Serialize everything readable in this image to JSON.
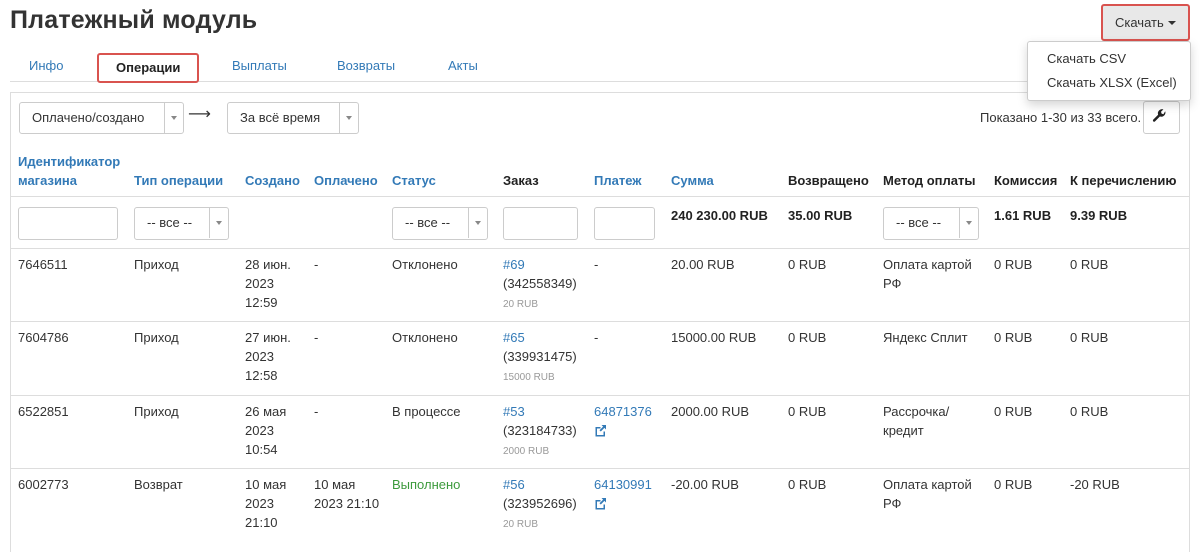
{
  "page": {
    "title": "Платежный модуль"
  },
  "tabs": [
    {
      "label": "Инфо"
    },
    {
      "label": "Операции"
    },
    {
      "label": "Выплаты"
    },
    {
      "label": "Возвраты"
    },
    {
      "label": "Акты"
    }
  ],
  "download": {
    "label": "Скачать",
    "menu": [
      "Скачать CSV",
      "Скачать XLSX (Excel)"
    ]
  },
  "filters": {
    "date_type": "Оплачено/создано",
    "arrow": "⟶",
    "period": "За всё время",
    "shown": "Показано 1-30 из 33 всего."
  },
  "columns": [
    {
      "line1": "Идентификатор",
      "line2": "магазина"
    },
    {
      "line1": "Тип операции"
    },
    {
      "line1": "Создано"
    },
    {
      "line1": "Оплачено"
    },
    {
      "line1": "Статус"
    },
    {
      "line1": "Заказ"
    },
    {
      "line1": "Платеж"
    },
    {
      "line1": "Сумма"
    },
    {
      "line1": "Возвращено"
    },
    {
      "line1": "Метод оплаты"
    },
    {
      "line1": "Комиссия"
    },
    {
      "line1": "К перечислению"
    }
  ],
  "filter_row": {
    "all_label": "-- все --",
    "totals": {
      "sum": "240 230.00 RUB",
      "refunded": "35.00 RUB",
      "commission": "1.61 RUB",
      "payout": "9.39 RUB"
    }
  },
  "rows": [
    {
      "shop_id": "7646511",
      "type": "Приход",
      "created": [
        "28 июн.",
        "2023",
        "12:59"
      ],
      "paid": "-",
      "status": "Отклонено",
      "status_color": "#333333",
      "order": "#69",
      "order_num": "(342558349)",
      "order_amount": "20 RUB",
      "payment": "-",
      "payment_link": false,
      "sum": "20.00 RUB",
      "refunded": "0 RUB",
      "method": [
        "Оплата картой",
        "РФ"
      ],
      "commission": "0 RUB",
      "payout": "0 RUB"
    },
    {
      "shop_id": "7604786",
      "type": "Приход",
      "created": [
        "27 июн.",
        "2023",
        "12:58"
      ],
      "paid": "-",
      "status": "Отклонено",
      "status_color": "#333333",
      "order": "#65",
      "order_num": "(339931475)",
      "order_amount": "15000 RUB",
      "payment": "-",
      "payment_link": false,
      "sum": "15000.00 RUB",
      "refunded": "0 RUB",
      "method": [
        "Яндекс Сплит"
      ],
      "commission": "0 RUB",
      "payout": "0 RUB"
    },
    {
      "shop_id": "6522851",
      "type": "Приход",
      "created": [
        "26 мая",
        "2023",
        "10:54"
      ],
      "paid": "-",
      "status": "В процессе",
      "status_color": "#333333",
      "order": "#53",
      "order_num": "(323184733)",
      "order_amount": "2000 RUB",
      "payment": "64871376",
      "payment_link": true,
      "sum": "2000.00 RUB",
      "refunded": "0 RUB",
      "method": [
        "Рассрочка/",
        "кредит"
      ],
      "commission": "0 RUB",
      "payout": "0 RUB"
    },
    {
      "shop_id": "6002773",
      "type": "Возврат",
      "created": [
        "10 мая",
        "2023",
        "21:10"
      ],
      "paid": "10 мая 2023 21:10",
      "status": "Выполнено",
      "status_color": "#3c9a3c",
      "order": "#56",
      "order_num": "(323952696)",
      "order_amount": "20 RUB",
      "payment": "64130991",
      "payment_link": true,
      "sum": "-20.00 RUB",
      "refunded": "0 RUB",
      "method": [
        "Оплата картой",
        "РФ"
      ],
      "commission": "0 RUB",
      "payout": "-20 RUB"
    }
  ],
  "icons": {
    "wrench": "wrench-icon",
    "external": "external-link-icon",
    "caret": "caret-down-icon"
  },
  "colors": {
    "link": "#337ab7",
    "highlight": "#d9534f",
    "success": "#3c9a3c"
  }
}
